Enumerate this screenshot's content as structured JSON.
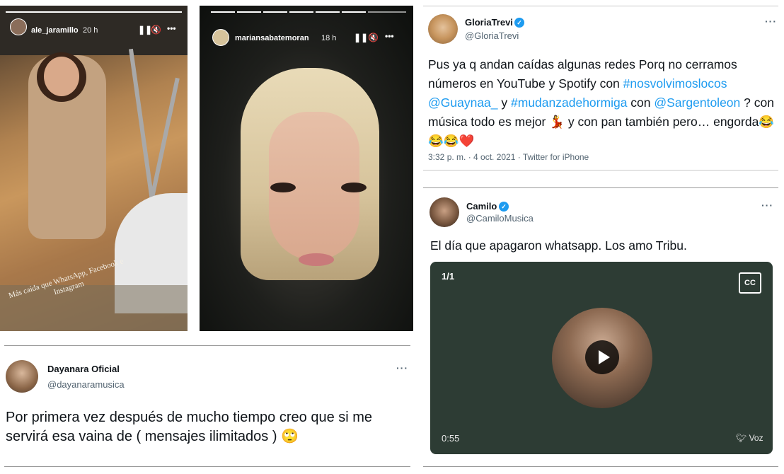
{
  "stories": [
    {
      "username": "ale_jaramillo",
      "time": "20 h",
      "pause_icon": "pause-icon",
      "mute_icon": "mute-icon",
      "more": "•••",
      "caption": "Más caída que WhatsApp, Facebook e Instagram"
    },
    {
      "username": "mariansabatemoran",
      "time": "18 h",
      "pause_icon": "pause-icon",
      "mute_icon": "mute-icon",
      "more": "•••"
    }
  ],
  "tweets": {
    "gloria": {
      "name": "GloriaTrevi",
      "handle": "@GloriaTrevi",
      "text_1": "Pus ya q andan caídas algunas redes Porq no cerramos números en YouTube y Spotify con ",
      "hashtag_1": "#nosvolvimoslocos",
      "mention_1": "@Guaynaa_",
      "text_2": " y ",
      "hashtag_2": "#mudanzadehormiga",
      "text_3": " con ",
      "mention_2": "@Sargentoleon",
      "text_4": " ? con música todo es mejor 💃 y con pan también pero… engorda😂😂😂❤️",
      "meta": "3:32 p. m. · 4 oct. 2021 · Twitter for iPhone"
    },
    "camilo": {
      "name": "Camilo",
      "handle": "@CamiloMusica",
      "text": "El día que apagaron whatsapp. Los amo Tribu.",
      "video": {
        "counter": "1/1",
        "cc": "CC",
        "duration": "0:55",
        "source": "Voz"
      }
    },
    "dayanara": {
      "name": "Dayanara Oficial",
      "handle": "@dayanaramusica",
      "text": "Por primera vez después de mucho tiempo creo que si me servirá esa vaina de ( mensajes ilimitados ) 🙄"
    }
  },
  "more_label": "···",
  "colors": {
    "link": "#1d9bf0",
    "video_bg": "#2d3c34",
    "verified": "#1d9bf0"
  }
}
